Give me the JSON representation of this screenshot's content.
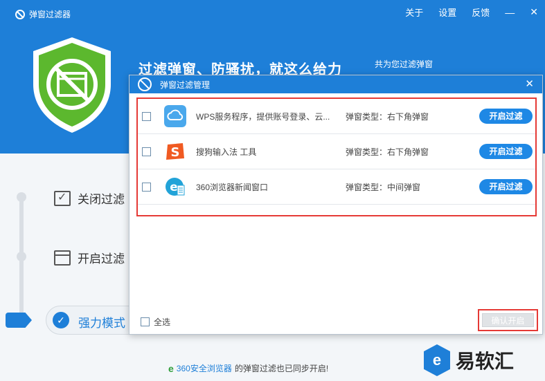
{
  "window": {
    "title": "弹窗过滤器",
    "menu": {
      "about": "关于",
      "settings": "设置",
      "feedback": "反馈"
    },
    "minimize": "—",
    "close": "✕",
    "slogan": "过滤弹窗、防骚扰，就这么给力",
    "sub_slogan": "共为您过滤弹窗"
  },
  "modes": [
    {
      "label": "关闭过滤"
    },
    {
      "label": "开启过滤"
    },
    {
      "label": "强力模式"
    }
  ],
  "footer": {
    "ie_icon": "e",
    "brand": "360安全浏览器",
    "text": "的弹窗过滤也已同步开启!"
  },
  "watermark": {
    "logo": "e",
    "text": "易软汇"
  },
  "dialog": {
    "title": "弹窗过滤管理",
    "close": "✕",
    "rows": [
      {
        "name": "WPS服务程序，提供账号登录、云...",
        "type": "弹窗类型：右下角弹窗",
        "button": "开启过滤",
        "icon": "cloud-icon"
      },
      {
        "name": "搜狗输入法 工具",
        "type": "弹窗类型：右下角弹窗",
        "button": "开启过滤",
        "icon": "sogou-icon"
      },
      {
        "name": "360浏览器新闻窗口",
        "type": "弹窗类型：中间弹窗",
        "button": "开启过滤",
        "icon": "browser-360-icon"
      }
    ],
    "select_all": "全选",
    "confirm": "确认开启"
  },
  "colors": {
    "accent": "#1e7fd8",
    "highlight": "#e53935",
    "shield": "#5cb82e"
  }
}
